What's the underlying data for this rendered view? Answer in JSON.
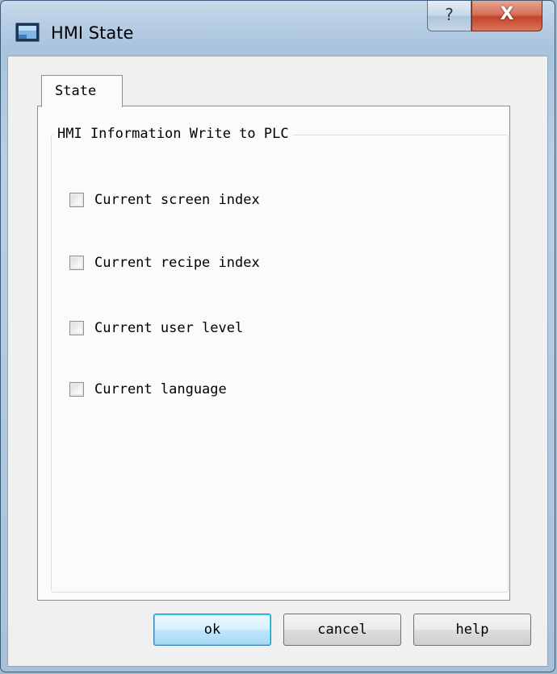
{
  "window": {
    "title": "HMI State",
    "help_glyph": "?",
    "close_glyph": "X"
  },
  "tabs": [
    {
      "label": "State",
      "selected": true
    }
  ],
  "group": {
    "title": "HMI Information Write to PLC",
    "options": [
      {
        "label": "Current screen index",
        "checked": false
      },
      {
        "label": "Current recipe index",
        "checked": false
      },
      {
        "label": "Current user level",
        "checked": false
      },
      {
        "label": "Current language",
        "checked": false
      }
    ]
  },
  "buttons": {
    "ok": "ok",
    "cancel": "cancel",
    "help": "help"
  },
  "colors": {
    "close_button": "#c2452a",
    "default_button_border": "#3c7fb1",
    "panel_background": "#fbfbfb"
  },
  "icons": {
    "window": "hmi-window-icon",
    "help": "question-mark-icon",
    "close": "close-x-icon"
  }
}
